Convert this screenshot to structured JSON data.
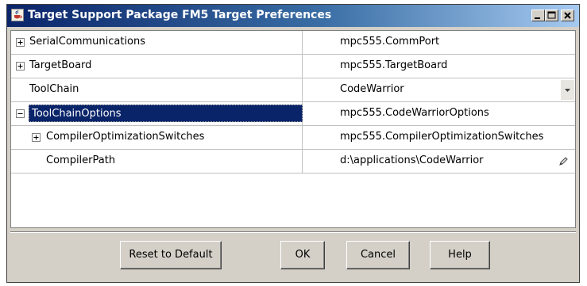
{
  "window": {
    "title": "Target Support Package FM5 Target Preferences",
    "icon": "java-cup-icon",
    "controls": [
      "minimize-icon",
      "maximize-icon",
      "close-icon"
    ]
  },
  "table": {
    "rows": [
      {
        "name": "SerialCommunications",
        "value": "mpc555.CommPort",
        "expander": "plus",
        "indent": 0
      },
      {
        "name": "TargetBoard",
        "value": "mpc555.TargetBoard",
        "expander": "plus",
        "indent": 0
      },
      {
        "name": "ToolChain",
        "value": "CodeWarrior",
        "expander": "none",
        "indent": 0,
        "editor": "dropdown"
      },
      {
        "name": "ToolChainOptions",
        "value": "mpc555.CodeWarriorOptions",
        "expander": "minus",
        "indent": 0,
        "selected": true
      },
      {
        "name": "CompilerOptimizationSwitches",
        "value": "mpc555.CompilerOptimizationSwitches",
        "expander": "plus",
        "indent": 1
      },
      {
        "name": "CompilerPath",
        "value": "d:\\applications\\CodeWarrior",
        "expander": "none",
        "indent": 1,
        "editor": "pencil"
      }
    ]
  },
  "buttons": {
    "reset": "Reset to Default",
    "ok": "OK",
    "cancel": "Cancel",
    "help": "Help"
  },
  "colors": {
    "title_bar_start": "#0a246a",
    "title_bar_end": "#a6caf0",
    "selection": "#0a246a",
    "dialog_bg": "#d4d0c8"
  }
}
